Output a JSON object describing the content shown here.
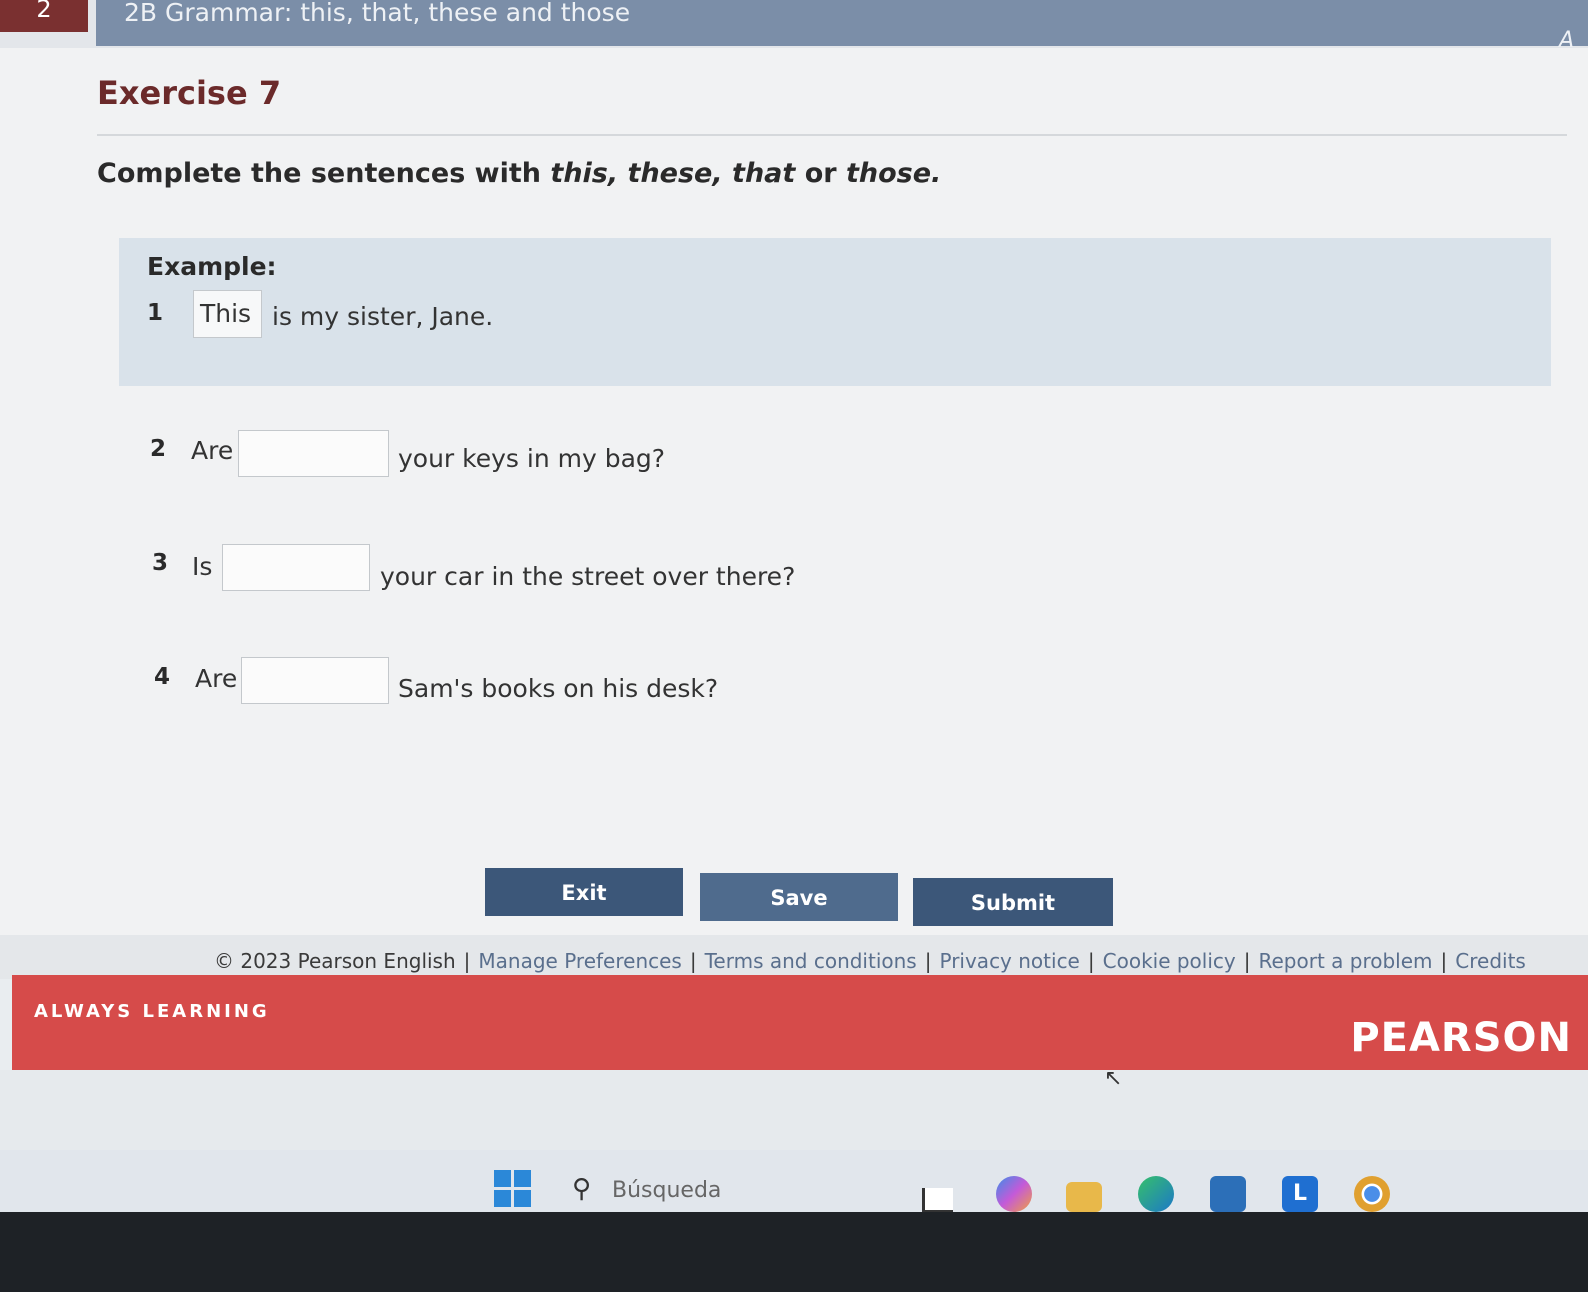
{
  "header": {
    "badge": "2",
    "title": "2B Grammar: this, that, these and those",
    "corner": "A"
  },
  "exercise": {
    "title": "Exercise 7",
    "instruction_prefix": "Complete the sentences with ",
    "opt1": "this,",
    "opt2": "these,",
    "opt3": "that",
    "or_word": " or ",
    "opt4": "those."
  },
  "example": {
    "label": "Example:",
    "number": "1",
    "answer": "This",
    "sentence": "is my sister, Jane."
  },
  "questions": [
    {
      "number": "2",
      "lead": "Are",
      "value": "",
      "rest": "your keys in my bag?"
    },
    {
      "number": "3",
      "lead": "Is",
      "value": "",
      "rest": "your car in the street over there?"
    },
    {
      "number": "4",
      "lead": "Are",
      "value": "",
      "rest": "Sam's books on his desk?"
    }
  ],
  "buttons": {
    "exit": "Exit",
    "save": "Save",
    "submit": "Submit"
  },
  "footer": {
    "copyright": "© 2023 Pearson English",
    "links": [
      "Manage Preferences",
      "Terms and conditions",
      "Privacy notice",
      "Cookie policy",
      "Report a problem",
      "Credits"
    ],
    "sep": "|"
  },
  "brand": {
    "tagline": "ALWAYS LEARNING",
    "name": "PEARSON"
  },
  "taskbar": {
    "search_placeholder": "Búsqueda",
    "icons": [
      "windows-start-icon",
      "search-icon",
      "file-explorer-shortcut-icon",
      "copilot-icon",
      "folder-icon",
      "edge-icon",
      "store-icon",
      "l-app-icon",
      "chrome-icon"
    ]
  },
  "colors": {
    "accent_red": "#d64b4a",
    "button_blue": "#3c5779",
    "title_maroon": "#6b2a2a",
    "link_blue": "#5a6f8d"
  }
}
